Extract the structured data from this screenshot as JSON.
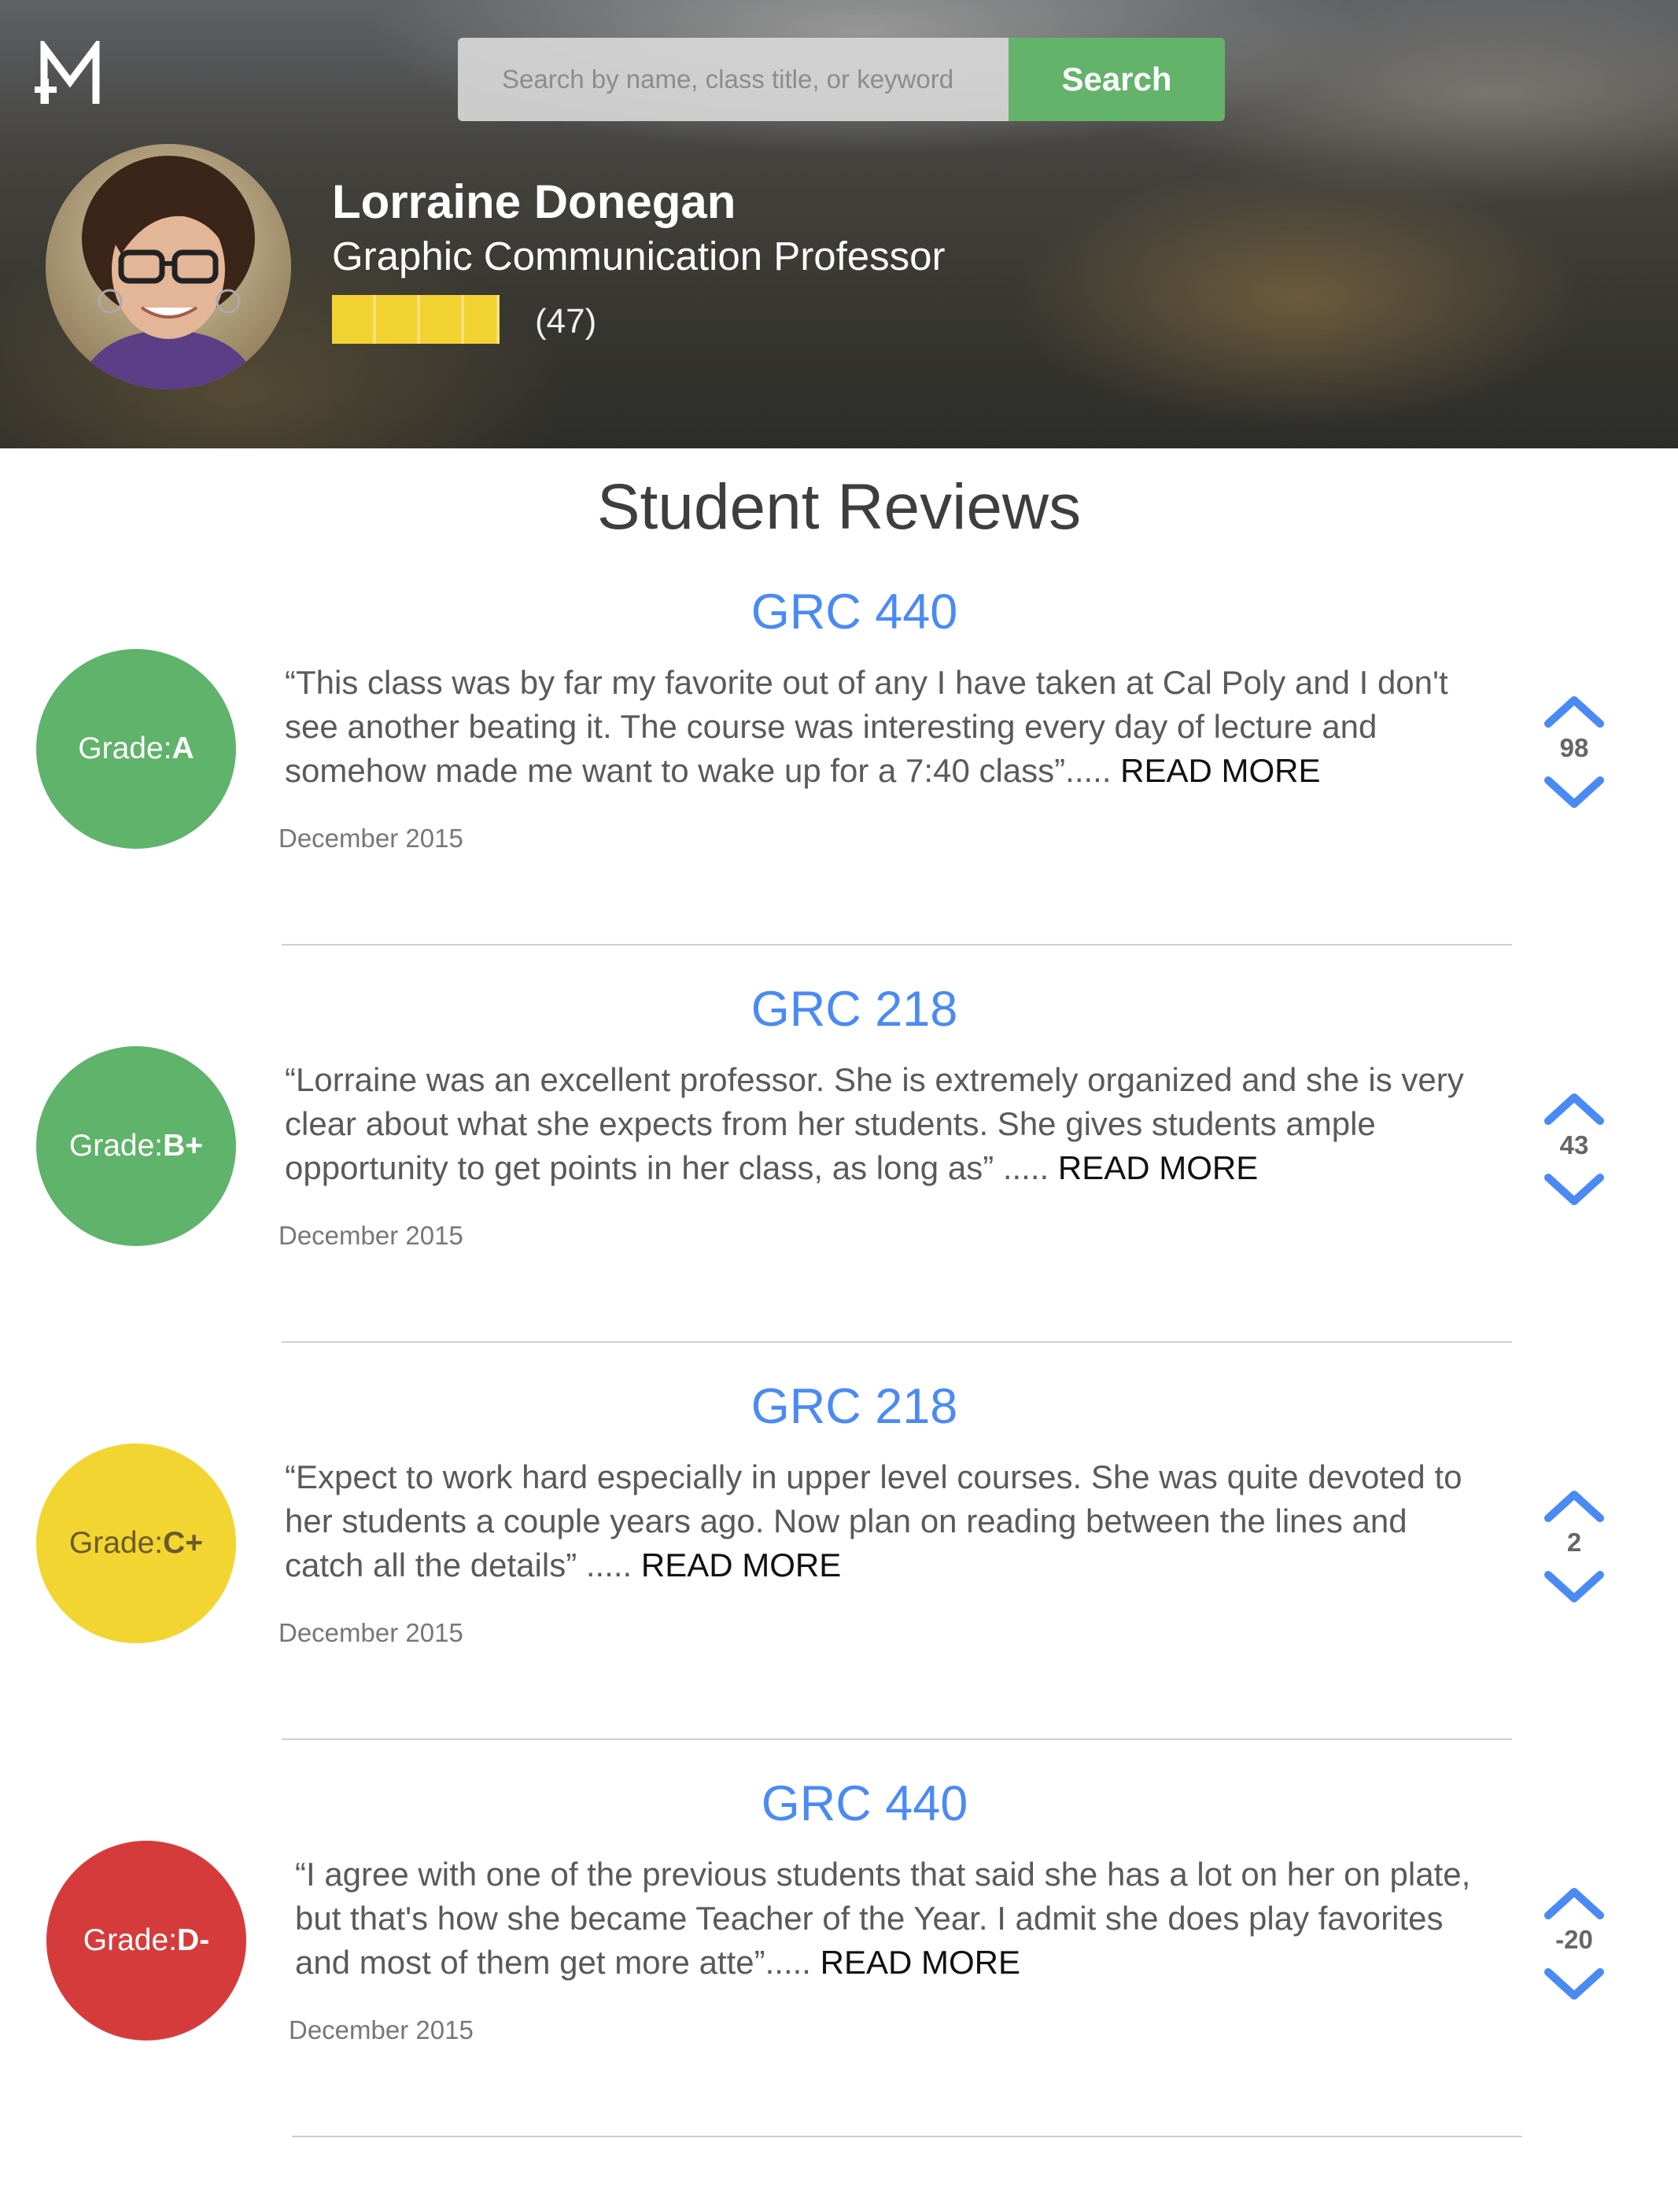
{
  "header": {
    "logo_icon": "m-plus-logo-icon",
    "search": {
      "placeholder": "Search by name, class title, or keyword",
      "value": "",
      "button_label": "Search"
    },
    "professor": {
      "name": "Lorraine Donegan",
      "title": "Graphic Communication Professor",
      "rating": 3.8,
      "rating_max": 5,
      "review_count": "(47)",
      "star_color": "#f2d230"
    }
  },
  "main": {
    "section_title": "Student Reviews",
    "reviews": [
      {
        "course": "GRC 440",
        "grade_label": "Grade:",
        "grade": "A",
        "grade_color": "#5fb36a",
        "text": "“This class was by far my favorite out of any I have taken at Cal Poly and I don't see another beating it. The course was interesting every day of lecture and somehow made me want to wake up for a 7:40 class”..... ",
        "read_more": "READ MORE",
        "date": "December 2015",
        "votes": "98"
      },
      {
        "course": "GRC 218",
        "grade_label": "Grade:",
        "grade": "B+",
        "grade_color": "#5fb36a",
        "text": "“Lorraine was an excellent professor. She is extremely organized and she is very clear about what she expects from her students. She gives students ample opportunity to get points in her class, as long as” ..... ",
        "read_more": "READ MORE",
        "date": "December 2015",
        "votes": "43"
      },
      {
        "course": "GRC 218",
        "grade_label": "Grade:",
        "grade": "C+",
        "grade_color": "#f2d530",
        "text": "“Expect to work hard especially in upper level courses. She was quite devoted to her students a couple years ago. Now plan on reading between the lines and catch all the details” ..... ",
        "read_more": "READ MORE",
        "date": "December 2015",
        "votes": "2"
      },
      {
        "course": "GRC 440",
        "grade_label": "Grade:",
        "grade": "D-",
        "grade_color": "#d63b3b",
        "text": "“I agree with one of the previous students that said she has a lot on her on plate, but that's how she became Teacher of the Year. I admit she does play favorites and most of them get more atte”..... ",
        "read_more": "READ MORE",
        "date": "December 2015",
        "votes": "-20"
      }
    ],
    "vote_icons": {
      "up": "chevron-up-icon",
      "down": "chevron-down-icon",
      "color": "#4a8af4"
    }
  }
}
